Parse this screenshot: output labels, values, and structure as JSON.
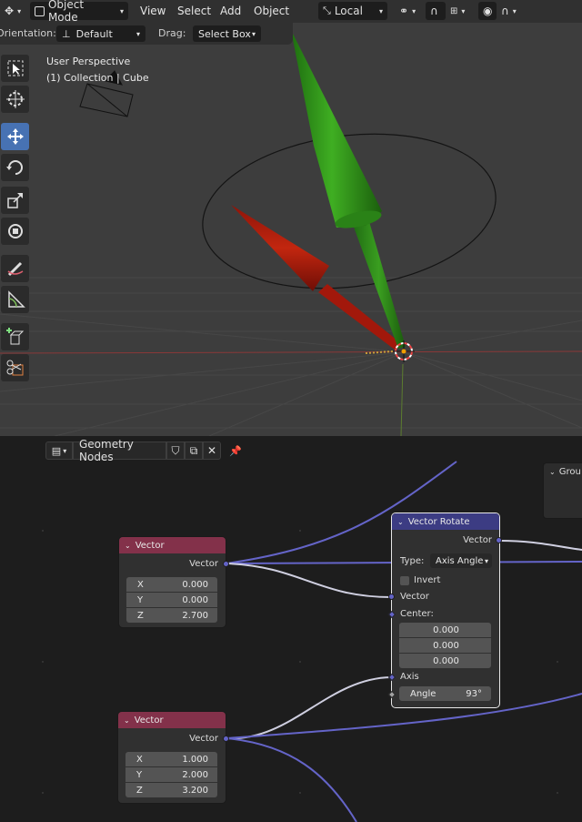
{
  "header": {
    "mode_label": "Object Mode",
    "menus": [
      "View",
      "Select",
      "Add",
      "Object"
    ],
    "transform_orientation": "Local"
  },
  "options": {
    "orientation_label": "Orientation:",
    "orientation_value": "Default",
    "drag_label": "Drag:",
    "drag_value": "Select Box"
  },
  "viewport": {
    "view_name": "User Perspective",
    "collection_info": "(1) Collection | Cube"
  },
  "toolbar": {
    "tools": [
      "select-box",
      "cursor",
      "move",
      "rotate",
      "scale",
      "transform",
      "annotate",
      "measure",
      "add-cube",
      "cut"
    ],
    "active": "move"
  },
  "node_editor": {
    "tree_name": "Geometry Nodes",
    "group_frame_label": "Grou",
    "nodes": {
      "vector1": {
        "title": "Vector",
        "output": "Vector",
        "x_label": "X",
        "x": "0.000",
        "y_label": "Y",
        "y": "0.000",
        "z_label": "Z",
        "z": "2.700"
      },
      "vector2": {
        "title": "Vector",
        "output": "Vector",
        "x_label": "X",
        "x": "1.000",
        "y_label": "Y",
        "y": "2.000",
        "z_label": "Z",
        "z": "3.200"
      },
      "rotate": {
        "title": "Vector Rotate",
        "output": "Vector",
        "type_label": "Type:",
        "type_value": "Axis Angle",
        "invert_label": "Invert",
        "vector_input": "Vector",
        "center_label": "Center:",
        "center": [
          "0.000",
          "0.000",
          "0.000"
        ],
        "axis_input": "Axis",
        "angle_label": "Angle",
        "angle_value": "93°"
      }
    }
  },
  "colors": {
    "accent": "#4772b3",
    "vector_node_header": "#83314a",
    "rotate_node_header": "#3c3c83",
    "socket_vector": "#6363c7",
    "arrow_green": "#2f9a16",
    "arrow_red": "#b0190c"
  }
}
